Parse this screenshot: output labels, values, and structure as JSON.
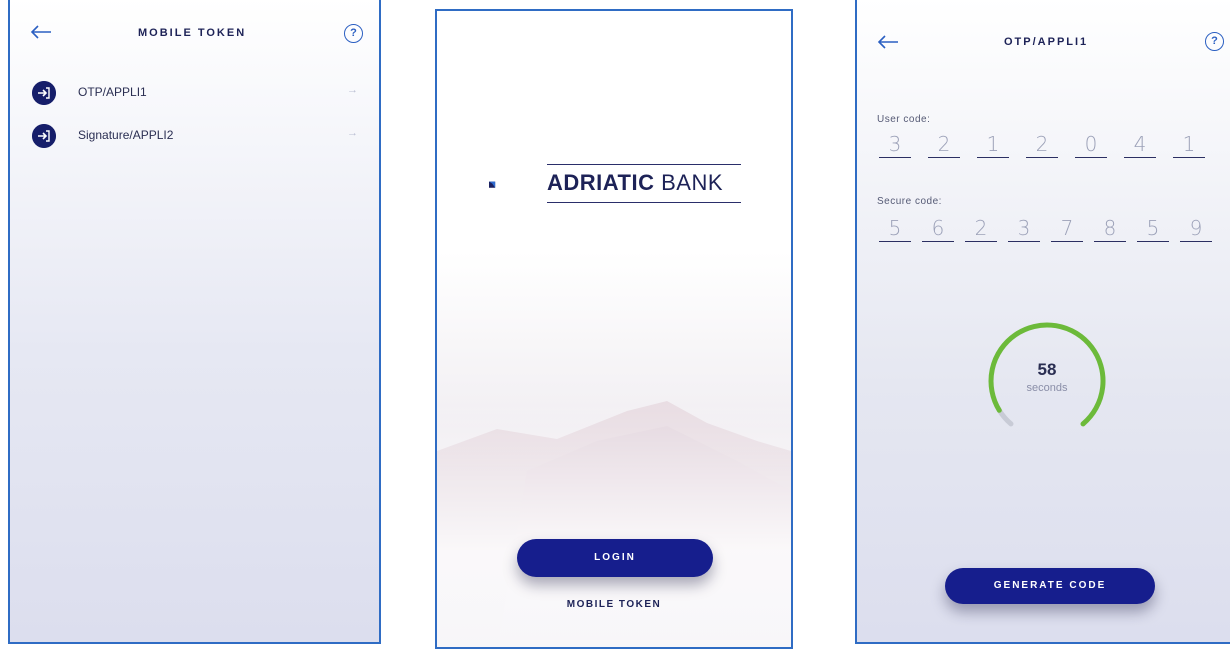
{
  "screen_mobile_token": {
    "title": "MOBILE TOKEN",
    "back_icon": "arrow-left-icon",
    "help_glyph": "?",
    "items": [
      {
        "label": "OTP/APPLI1",
        "icon": "login-arrow-icon",
        "arrow": "→"
      },
      {
        "label": "Signature/APPLI2",
        "icon": "login-arrow-icon",
        "arrow": "→"
      }
    ]
  },
  "screen_login": {
    "brand_bold": "ADRIATIC",
    "brand_rest": "BANK",
    "login_label": "LOGIN",
    "mobile_token_link": "MOBILE TOKEN"
  },
  "screen_otp": {
    "title": "OTP/APPLI1",
    "help_glyph": "?",
    "user_code_label": "User code:",
    "user_code_digits": [
      "3",
      "2",
      "1",
      "2",
      "0",
      "4",
      "1"
    ],
    "secure_code_label": "Secure code:",
    "secure_code_digits": [
      "5",
      "6",
      "2",
      "3",
      "7",
      "8",
      "5",
      "9"
    ],
    "timer_value": "58",
    "timer_unit": "seconds",
    "timer_progress_fraction": 0.97,
    "generate_label": "GENERATE CODE"
  },
  "colors": {
    "brand_navy": "#161e8d",
    "frame_blue": "#2f6cc4",
    "timer_green": "#6cba3a",
    "timer_track": "#c8cbd6"
  }
}
